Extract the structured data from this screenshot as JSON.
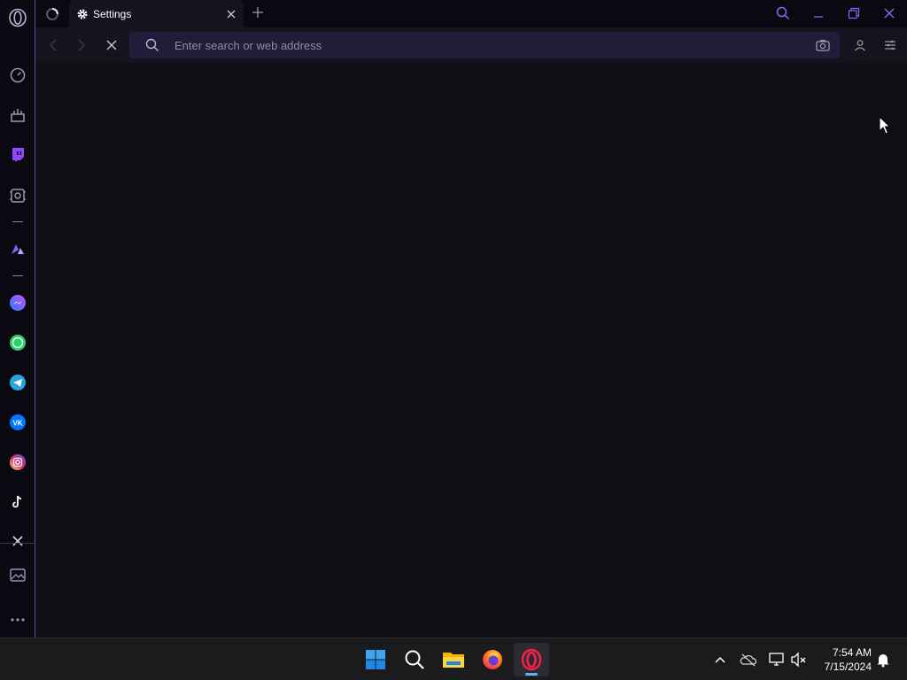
{
  "browser": {
    "tab": {
      "title": "Settings"
    },
    "address_bar": {
      "value": "",
      "placeholder": "Enter search or web address"
    }
  },
  "sidebar": {
    "items": [
      {
        "name": "opera-menu"
      },
      {
        "name": "speed-dial"
      },
      {
        "name": "workspaces"
      },
      {
        "name": "twitch"
      },
      {
        "name": "aria-ai"
      },
      {
        "name": "extensions"
      },
      {
        "name": "messenger"
      },
      {
        "name": "whatsapp"
      },
      {
        "name": "telegram"
      },
      {
        "name": "vk"
      },
      {
        "name": "instagram"
      },
      {
        "name": "tiktok"
      },
      {
        "name": "x"
      },
      {
        "name": "gallery"
      },
      {
        "name": "more"
      }
    ]
  },
  "taskbar": {
    "apps": [
      "start",
      "search",
      "file-explorer",
      "firefox",
      "opera-gx"
    ],
    "active_app": "opera-gx",
    "clock": {
      "time": "7:54 AM",
      "date": "7/15/2024"
    }
  },
  "colors": {
    "accent": "#7b5cff",
    "sidebar_border": "#5a4a9a",
    "urlbar": "#221c3a",
    "content": "#0f0e14"
  }
}
